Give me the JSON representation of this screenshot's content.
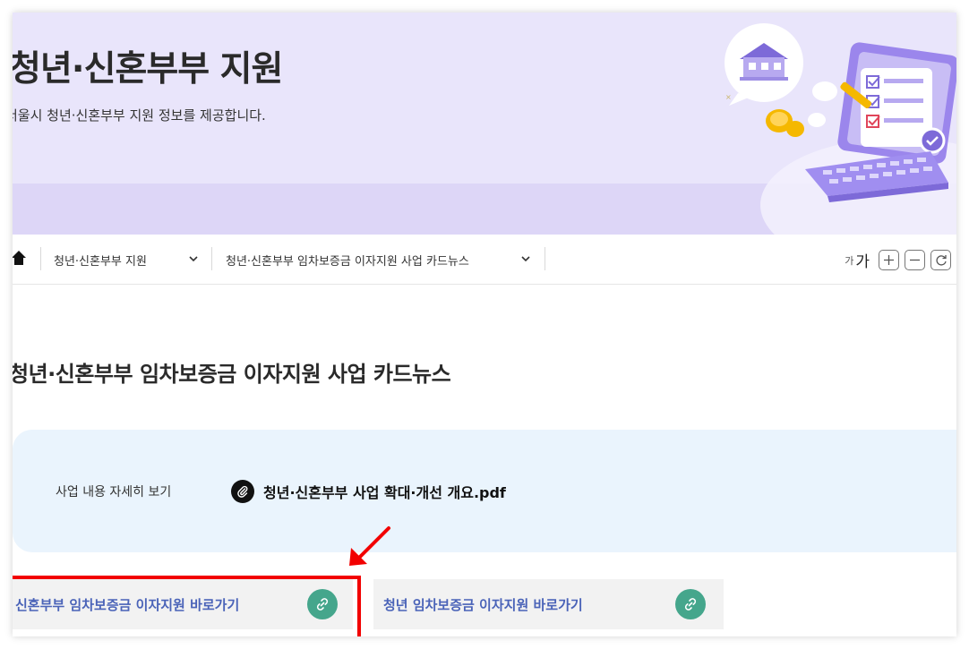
{
  "hero": {
    "title": "청년·신혼부부 지원",
    "subtitle": "서울시 청년·신혼부부 지원 정보를 제공합니다."
  },
  "breadcrumb": {
    "items": [
      {
        "label": "청년·신혼부부 지원"
      },
      {
        "label": "청년·신혼부부 임차보증금 이자지원 사업 카드뉴스"
      }
    ]
  },
  "font_size_control": {
    "small_label": "가",
    "large_label": "가"
  },
  "page": {
    "title": "청년·신혼부부 임차보증금 이자지원 사업 카드뉴스"
  },
  "info_box": {
    "label": "사업 내용 자세히 보기",
    "file_name": "청년·신혼부부 사업 확대·개선 개요.pdf"
  },
  "links": [
    {
      "label": "신혼부부 임차보증금 이자지원 바로가기"
    },
    {
      "label": "청년 임차보증금 이자지원 바로가기"
    }
  ],
  "colors": {
    "hero_bg": "#e9e5fb",
    "info_bg": "#eaf4fd",
    "link_text": "#4a63b8",
    "link_icon_bg": "#45a68c",
    "annotation": "#f20000"
  },
  "icons": [
    "home-icon",
    "chevron-down-icon",
    "plus-icon",
    "minus-icon",
    "reset-icon",
    "paperclip-icon",
    "link-icon",
    "arrow-annotation-icon"
  ]
}
